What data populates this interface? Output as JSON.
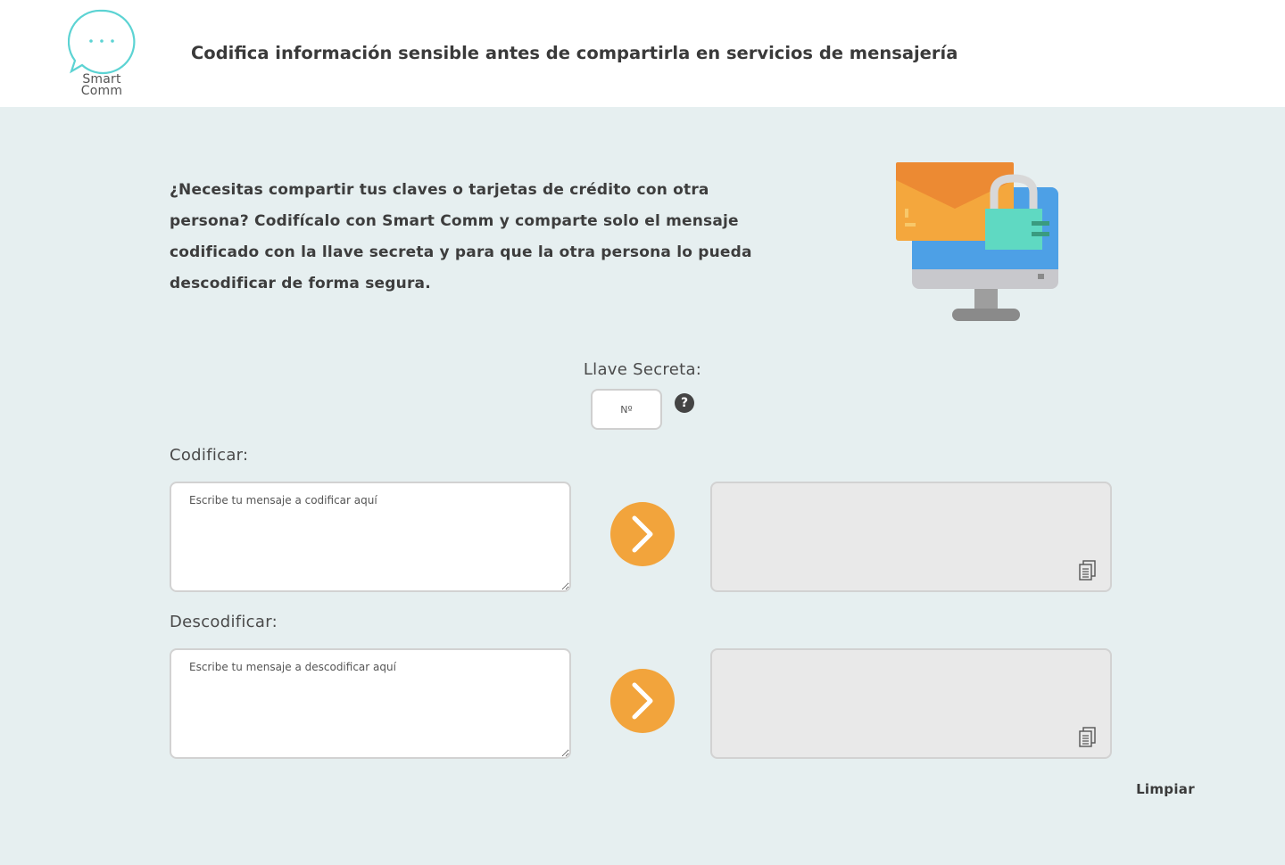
{
  "header": {
    "logo_line1": "Smart",
    "logo_line2": "Comm",
    "title": "Codifica información sensible antes de compartirla en servicios de mensajería"
  },
  "intro": {
    "text": "¿Necesitas compartir tus claves o tarjetas de crédito con otra persona? Codifícalo con Smart Comm y comparte solo el mensaje codificado con la llave secreta y para que la otra persona lo pueda descodificar de forma segura."
  },
  "key": {
    "label": "Llave Secreta:",
    "placeholder": "Nº",
    "help_symbol": "?"
  },
  "encode": {
    "label": "Codificar:",
    "placeholder": "Escribe tu mensaje a codificar aquí",
    "output": ""
  },
  "decode": {
    "label": "Descodificar:",
    "placeholder": "Escribe tu mensaje a descodificar aquí",
    "output": ""
  },
  "actions": {
    "clear_label": "Limpiar"
  },
  "icons": {
    "logo": "chat-bubble-icon",
    "illustration": "computer-mail-lock-icon",
    "help": "question-mark-icon",
    "go": "chevron-right-icon",
    "copy": "copy-clipboard-icon"
  },
  "colors": {
    "background": "#e6eff0",
    "header": "#ffffff",
    "accent_orange": "#f2a43c",
    "logo_teal": "#5cd3d3",
    "output_bg": "#e9e9e9"
  }
}
